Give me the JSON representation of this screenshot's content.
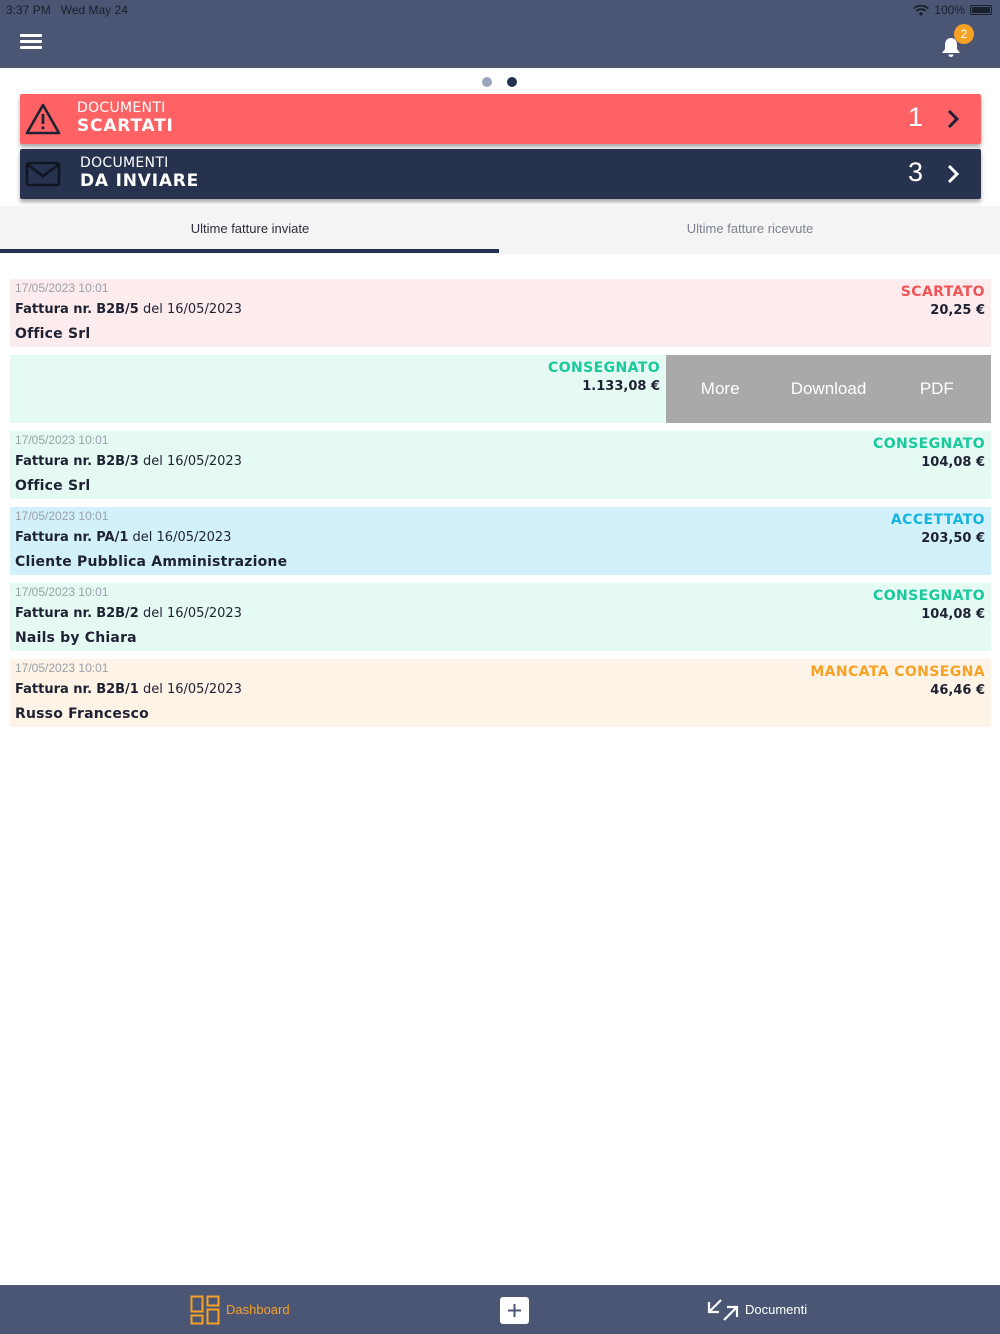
{
  "status_bar": {
    "time": "3:37 PM",
    "date": "Wed May 24",
    "battery": "100%"
  },
  "header": {
    "notifications_count": "2"
  },
  "carousel": {
    "pages": 2,
    "active": 2
  },
  "cards": [
    {
      "line1": "DOCUMENTI",
      "line2": "SCARTATI",
      "count": "1",
      "color": "#ff6264"
    },
    {
      "line1": "DOCUMENTI",
      "line2": "DA INVIARE",
      "count": "3",
      "color": "#27324e"
    }
  ],
  "tabs": [
    {
      "label": "Ultime fatture inviate",
      "active": true
    },
    {
      "label": "Ultime fatture ricevute",
      "active": false
    }
  ],
  "invoices": [
    {
      "date": "17/05/2023 10:01",
      "prefix": "Fattura nr.",
      "number": "B2B/5",
      "del": "del 16/05/2023",
      "customer": "Office Srl",
      "status": "SCARTATO",
      "amount": "20,25 €",
      "status_color": "#f05556",
      "bg": "#fdecee"
    },
    {
      "status": "CONSEGNATO",
      "amount": "1.133,08 €",
      "status_color": "#18c99a",
      "bg": "#e6faf4",
      "swiped": true
    },
    {
      "date": "17/05/2023 10:01",
      "prefix": "Fattura nr.",
      "number": "B2B/3",
      "del": "del 16/05/2023",
      "customer": "Office Srl",
      "status": "CONSEGNATO",
      "amount": "104,08 €",
      "status_color": "#18c99a",
      "bg": "#e6faf4"
    },
    {
      "date": "17/05/2023 10:01",
      "prefix": "Fattura nr.",
      "number": "PA/1",
      "del": "del 16/05/2023",
      "customer": "Cliente Pubblica Amministrazione",
      "status": "ACCETTATO",
      "amount": "203,50 €",
      "status_color": "#12b5e0",
      "bg": "#d2f1fb"
    },
    {
      "date": "17/05/2023 10:01",
      "prefix": "Fattura nr.",
      "number": "B2B/2",
      "del": "del 16/05/2023",
      "customer": "Nails by Chiara",
      "status": "CONSEGNATO",
      "amount": "104,08 €",
      "status_color": "#18c99a",
      "bg": "#e6faf4"
    },
    {
      "date": "17/05/2023 10:01",
      "prefix": "Fattura nr.",
      "number": "B2B/1",
      "del": "del 16/05/2023",
      "customer": "Russo Francesco",
      "status": "MANCATA CONSEGNA",
      "amount": "46,46 €",
      "status_color": "#f7a125",
      "bg": "#fdf3e6"
    }
  ],
  "swipe_actions": [
    "More",
    "Download",
    "PDF"
  ],
  "bottom_nav": {
    "dashboard": "Dashboard",
    "documenti": "Documenti"
  }
}
